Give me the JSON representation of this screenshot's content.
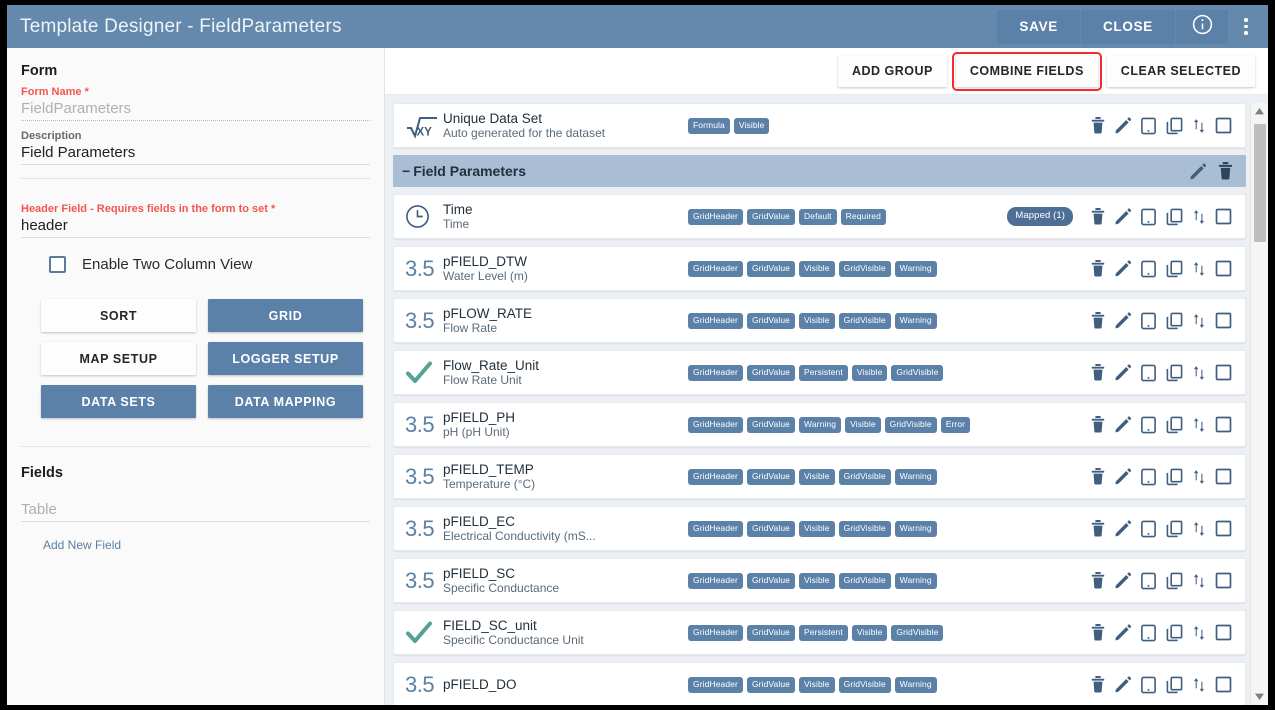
{
  "window": {
    "title": "Template Designer - FieldParameters"
  },
  "titlebar": {
    "save_label": "SAVE",
    "close_label": "CLOSE",
    "info_icon": "info-circle-icon",
    "menu_icon": "kebab-menu-icon"
  },
  "left_panel": {
    "form_section_title": "Form",
    "form_name_label": "Form Name *",
    "form_name_value": "FieldParameters",
    "description_label": "Description",
    "description_value": "Field Parameters",
    "header_field_label": "Header Field - Requires fields in the form to set *",
    "header_field_value": "header",
    "two_column_label": "Enable Two Column View",
    "buttons": [
      {
        "label": "SORT",
        "style": "light"
      },
      {
        "label": "GRID",
        "style": "dark"
      },
      {
        "label": "MAP SETUP",
        "style": "light"
      },
      {
        "label": "LOGGER SETUP",
        "style": "dark"
      },
      {
        "label": "DATA SETS",
        "style": "dark"
      },
      {
        "label": "DATA MAPPING",
        "style": "dark"
      }
    ],
    "fields_section_title": "Fields",
    "table_placeholder": "Table",
    "add_new_field_label": "Add New Field"
  },
  "right_toolbar": {
    "add_group_label": "ADD GROUP",
    "combine_fields_label": "COMBINE FIELDS",
    "clear_selected_label": "CLEAR SELECTED",
    "highlight_color": "#ef2b2b"
  },
  "dataset_row": {
    "icon": "sqrt-xy-formula-icon",
    "name": "Unique Data Set",
    "description": "Auto generated for the dataset",
    "chips": [
      "Formula",
      "Visible"
    ]
  },
  "group": {
    "title": "Field Parameters",
    "collapse_symbol": "−",
    "edit_icon": "pencil-icon",
    "delete_icon": "trash-icon"
  },
  "row_actions": {
    "delete_icon": "trash-icon",
    "edit_icon": "pencil-icon",
    "mobile_icon": "tablet-icon",
    "copy_icon": "duplicate-icon",
    "reorder_icon": "sort-updown-icon",
    "select_icon": "checkbox-icon"
  },
  "fields": [
    {
      "icon": "clock-icon",
      "name": "Time",
      "description": "Time",
      "chips": [
        "GridHeader",
        "GridValue",
        "Default",
        "Required"
      ],
      "badge": "Mapped  (1)"
    },
    {
      "icon": "number-3-5-icon",
      "name": "pFIELD_DTW",
      "description": "Water Level (m)",
      "chips": [
        "GridHeader",
        "GridValue",
        "Visible",
        "GridVisible",
        "Warning"
      ],
      "badge": ""
    },
    {
      "icon": "number-3-5-icon",
      "name": "pFLOW_RATE",
      "description": "Flow Rate",
      "chips": [
        "GridHeader",
        "GridValue",
        "Visible",
        "GridVisible",
        "Warning"
      ],
      "badge": ""
    },
    {
      "icon": "check-icon",
      "name": "Flow_Rate_Unit",
      "description": "Flow Rate Unit",
      "chips": [
        "GridHeader",
        "GridValue",
        "Persistent",
        "Visible",
        "GridVisible"
      ],
      "badge": ""
    },
    {
      "icon": "number-3-5-icon",
      "name": "pFIELD_PH",
      "description": "pH (pH Unit)",
      "chips": [
        "GridHeader",
        "GridValue",
        "Warning",
        "Visible",
        "GridVisible",
        "Error"
      ],
      "badge": ""
    },
    {
      "icon": "number-3-5-icon",
      "name": "pFIELD_TEMP",
      "description": "Temperature (°C)",
      "chips": [
        "GridHeader",
        "GridValue",
        "Visible",
        "GridVisible",
        "Warning"
      ],
      "badge": ""
    },
    {
      "icon": "number-3-5-icon",
      "name": "pFIELD_EC",
      "description": "Electrical Conductivity (mS...",
      "chips": [
        "GridHeader",
        "GridValue",
        "Visible",
        "GridVisible",
        "Warning"
      ],
      "badge": ""
    },
    {
      "icon": "number-3-5-icon",
      "name": "pFIELD_SC",
      "description": "Specific Conductance",
      "chips": [
        "GridHeader",
        "GridValue",
        "Visible",
        "GridVisible",
        "Warning"
      ],
      "badge": ""
    },
    {
      "icon": "check-icon",
      "name": "FIELD_SC_unit",
      "description": "Specific Conductance Unit",
      "chips": [
        "GridHeader",
        "GridValue",
        "Persistent",
        "Visible",
        "GridVisible"
      ],
      "badge": ""
    },
    {
      "icon": "number-3-5-icon",
      "name": "pFIELD_DO",
      "description": "",
      "chips": [
        "GridHeader",
        "GridValue",
        "Visible",
        "GridVisible",
        "Warning"
      ],
      "badge": ""
    }
  ],
  "icon_glyphs": {
    "number_icon_label": "3.5"
  },
  "colors": {
    "titlebar": "#6588ad",
    "accent": "#5c81a9",
    "group_header": "#a9bdd4",
    "chip": "#5c81a9",
    "check_green": "#56a096",
    "required_red": "#f4564e"
  }
}
